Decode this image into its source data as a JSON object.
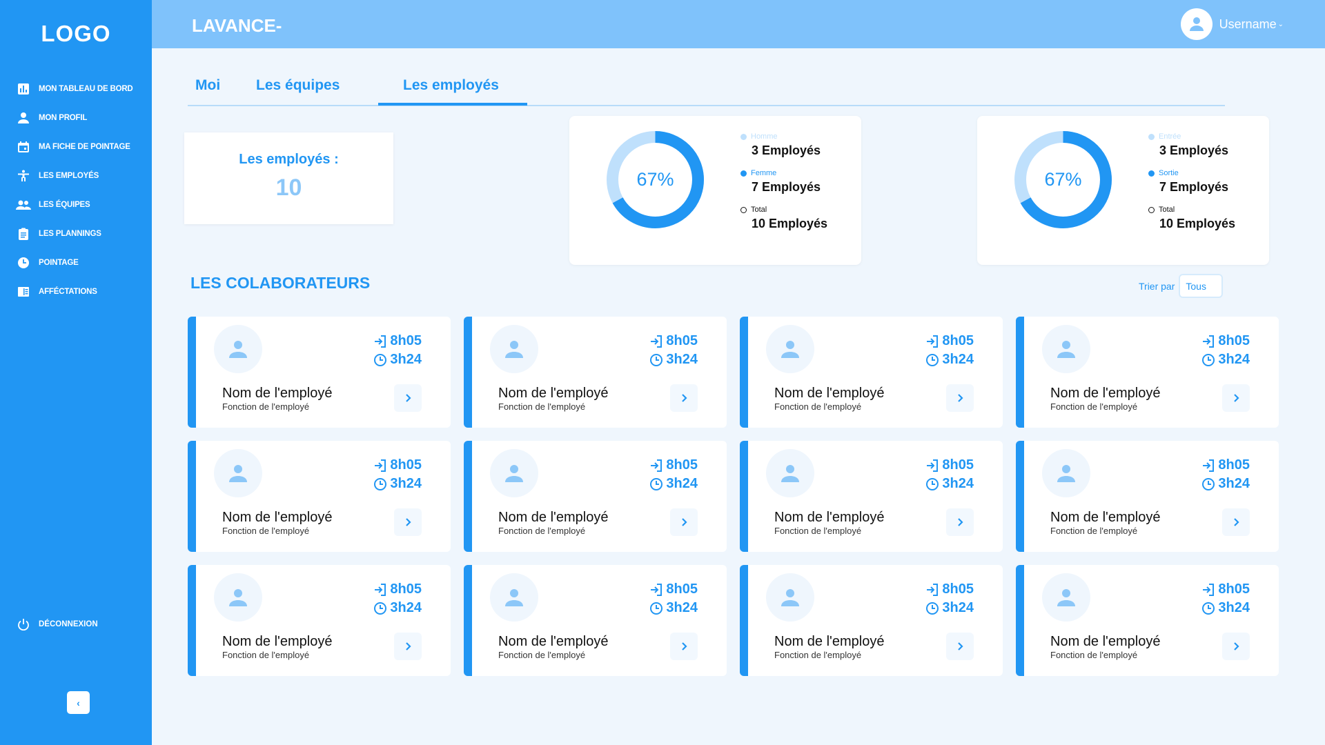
{
  "sidebar": {
    "logo": "LOGO",
    "items": [
      {
        "label": "MON TABLEAU DE BORD",
        "icon": "chart-icon"
      },
      {
        "label": "MON PROFIL",
        "icon": "person-icon"
      },
      {
        "label": "MA FICHE DE POINTAGE",
        "icon": "calendar-icon"
      },
      {
        "label": "LES EMPLOYÉS",
        "icon": "accessibility-icon"
      },
      {
        "label": "LES ÉQUIPES",
        "icon": "group-icon"
      },
      {
        "label": "LES PLANNINGS",
        "icon": "clipboard-icon"
      },
      {
        "label": "POINTAGE",
        "icon": "clock-icon"
      },
      {
        "label": "AFFÉCTATIONS",
        "icon": "book-icon"
      }
    ],
    "logout": "DÉCONNEXION",
    "collapse": "‹"
  },
  "header": {
    "title": "LAVANCE-",
    "username": "Username"
  },
  "tabs": [
    "Moi",
    "Les équipes",
    "Les employés"
  ],
  "active_tab": "Les employés",
  "count": {
    "label": "Les employés  :",
    "value": "10"
  },
  "stats": [
    {
      "percent": 67,
      "percent_label": "67%",
      "items": [
        {
          "name": "Homme",
          "value": "3 Employés",
          "color": "#bfe0fc"
        },
        {
          "name": "Femme",
          "value": "7 Employés",
          "color": "#2196f3"
        },
        {
          "name": "Total",
          "value": "10 Employés",
          "color": "#ffffff"
        }
      ]
    },
    {
      "percent": 67,
      "percent_label": "67%",
      "items": [
        {
          "name": "Entrée",
          "value": "3 Employés",
          "color": "#bfe0fc"
        },
        {
          "name": "Sortie",
          "value": "7 Employés",
          "color": "#2196f3"
        },
        {
          "name": "Total",
          "value": "10 Employés",
          "color": "#ffffff"
        }
      ]
    }
  ],
  "section": {
    "title": "LES COLABORATEURS",
    "sort_label": "Trier par",
    "sort_value": "Tous"
  },
  "employees": [
    {
      "name": "Nom de l'employé",
      "role": "Fonction de l'employé",
      "in": "8h05",
      "duration": "3h24"
    },
    {
      "name": "Nom de l'employé",
      "role": "Fonction de l'employé",
      "in": "8h05",
      "duration": "3h24"
    },
    {
      "name": "Nom de l'employé",
      "role": "Fonction de l'employé",
      "in": "8h05",
      "duration": "3h24"
    },
    {
      "name": "Nom de l'employé",
      "role": "Fonction de l'employé",
      "in": "8h05",
      "duration": "3h24"
    },
    {
      "name": "Nom de l'employé",
      "role": "Fonction de l'employé",
      "in": "8h05",
      "duration": "3h24"
    },
    {
      "name": "Nom de l'employé",
      "role": "Fonction de l'employé",
      "in": "8h05",
      "duration": "3h24"
    },
    {
      "name": "Nom de l'employé",
      "role": "Fonction de l'employé",
      "in": "8h05",
      "duration": "3h24"
    },
    {
      "name": "Nom de l'employé",
      "role": "Fonction de l'employé",
      "in": "8h05",
      "duration": "3h24"
    },
    {
      "name": "Nom de l'employé",
      "role": "Fonction de l'employé",
      "in": "8h05",
      "duration": "3h24"
    },
    {
      "name": "Nom de l'employé",
      "role": "Fonction de l'employé",
      "in": "8h05",
      "duration": "3h24"
    },
    {
      "name": "Nom de l'employé",
      "role": "Fonction de l'employé",
      "in": "8h05",
      "duration": "3h24"
    },
    {
      "name": "Nom de l'employé",
      "role": "Fonction de l'employé",
      "in": "8h05",
      "duration": "3h24"
    }
  ],
  "colors": {
    "primary": "#2196f3",
    "header": "#7fc2fb",
    "background": "#eff6fd",
    "light": "#bfe0fc"
  }
}
